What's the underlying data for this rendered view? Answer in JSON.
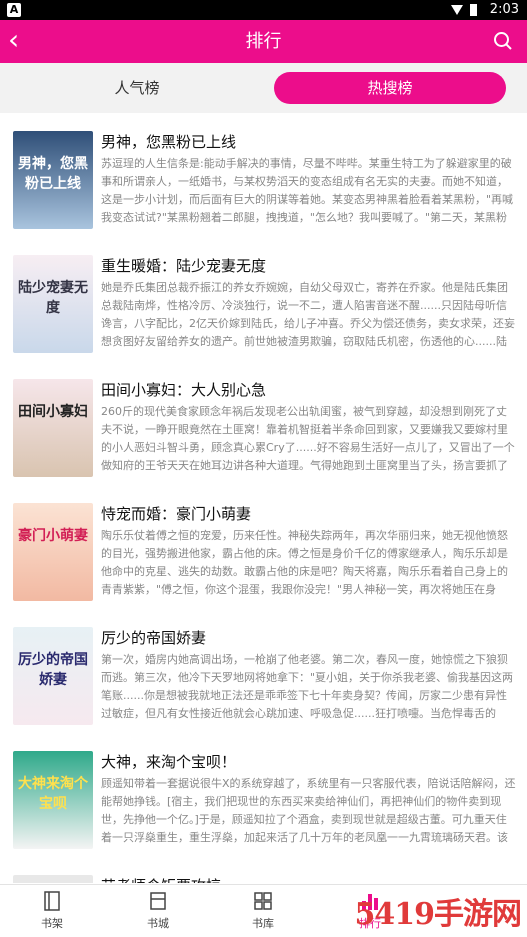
{
  "status": {
    "logo": "A",
    "time": "2:03"
  },
  "header": {
    "title": "排行"
  },
  "tabs": [
    {
      "label": "人气榜"
    },
    {
      "label": "热搜榜"
    }
  ],
  "books": [
    {
      "title": "男神，您黑粉已上线",
      "cover_text": "男神，您黑粉已上线",
      "desc": "苏逗珵的人生信条是:能动手解决的事情，尽量不哔哔。某重生特工为了躲避家里的破事和所谓亲人，一纸婚书，与某权势滔天的变态组成有名无实的夫妻。而她不知道，这是一步小计划，而后面有巨大的阴谋等着她。某变态男神黑着脸看着某黑粉，\"再喊我变态试试?\"某黑粉翘着二郎腿，拽拽道，\"怎么地？我叫要喊了。\"第二天，某黑粉完全下不了..."
    },
    {
      "title": "重生暖婚：陆少宠妻无度",
      "cover_text": "陆少宠妻无度",
      "desc": "她是乔氏集团总裁乔振江的养女乔婉婉，自幼父母双亡，寄养在乔家。他是陆氏集团总裁陆南烨，性格冷厉、冷淡独行，说一不二，遭人陷害音迷不醒......只因陆母听信谗言，八字配比，2亿天价嫁到陆氏，给儿子冲喜。乔父为偿还债务，卖女求荣，还妄想贪图好友留给养女的遗产。前世她被渣男欺骗，窃取陆氏机密，伤透他的心......陆南烨不计前嫌，..."
    },
    {
      "title": "田间小寡妇：大人别心急",
      "cover_text": "田间小寡妇",
      "desc": "260斤的现代美食家顾念年祸后发现老公出轨闺蜜，被气到穿越，却没想到刚死了丈夫不说，一睁开眼竟然在土匪窝！靠着机智挺着半条命回到家，又要嫌我又要嫁村里的小人恶妇斗智斗勇，顾念真心累Cry了......好不容易生活好一点儿了，又冒出了一个做知府的王爷天天在她耳边讲各种大道理。气得她跑到土匪窝里当了头，扬言要抓了知府做压寨相公..."
    },
    {
      "title": "恃宠而婚：豪门小萌妻",
      "cover_text": "豪门小萌妻",
      "desc": "陶乐乐仗着傅之恒的宠爱，历来任性。神秘失踪两年，再次华丽归来，她无视他愤怒的目光，强势搬进他家，霸占他的床。傅之恒是身价千亿的傅家继承人，陶乐乐却是他命中的克星、逃失的劫数。敢霸占他的床是吧？陶天将嘉，陶乐乐看着自己身上的青青紫紫，\"傅之恒，你这个混蛋，我跟你没完！\"男人神秘一笑，再次将她压在身下，\"宝贝儿..."
    },
    {
      "title": "厉少的帝国娇妻",
      "cover_text": "厉少的帝国娇妻",
      "desc": "第一次，婚房内她高调出场，一枪崩了他老婆。第二次，春风一度，她惊慌之下狼狈而逃。第三次，他冷下天罗地网将她拿下：\"夏小姐，关于你杀我老婆、偷我基因这两笔账......你是想被我就地正法还是乖乖签下七十年卖身契？传闻，厉家二少患有异性过敏症，但凡有女性接近他就会心跳加速、呼吸急促......狂打喷嚏。当危悍毒舌的她，处处被..."
    },
    {
      "title": "大神，来淘个宝呗！",
      "cover_text": "大神来淘个宝呗",
      "desc": "顾遥知带着一套据说很牛X的系统穿越了，系统里有一只客服代表，陪说话陪解闷，还能帮她挣钱。[宿主，我们把现世的东西买来卖给神仙们，再把神仙们的物件卖到现世，先挣他一个亿。]于是，顾遥知拉了个酒盒，卖到现世就是超级古董。可九重天住着一只浮燊重生，重生浮燊，加起来活了几十万年的老凤凰一一九霄琉璃砀天君。该老凤凰傲骄..."
    },
    {
      "title": "艺考师令矩要攻掠",
      "cover_text": "",
      "desc": ""
    }
  ],
  "bottom_nav": [
    {
      "label": "书架",
      "icon": "book-icon"
    },
    {
      "label": "书城",
      "icon": "bookstore-icon"
    },
    {
      "label": "书库",
      "icon": "grid-icon"
    },
    {
      "label": "排行",
      "icon": "ranking-icon"
    }
  ],
  "watermark": "5419手游网",
  "colors": {
    "accent": "#ec0d8b"
  }
}
